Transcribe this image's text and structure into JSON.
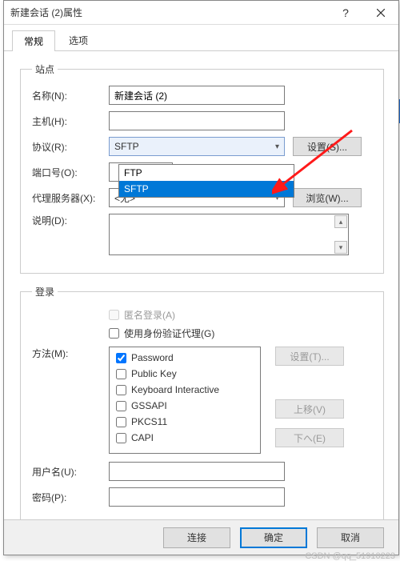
{
  "window": {
    "title": "新建会话 (2)属性",
    "help_icon": "?",
    "close_icon": "×"
  },
  "tabs": {
    "general": "常规",
    "options": "选项"
  },
  "site": {
    "legend": "站点",
    "name_label": "名称(N):",
    "name_value": "新建会话 (2)",
    "host_label": "主机(H):",
    "host_value": "",
    "protocol_label": "协议(R):",
    "protocol_value": "SFTP",
    "settings_btn": "设置(S)...",
    "port_label": "端口号(O):",
    "port_value": "",
    "proxy_label": "代理服务器(X):",
    "proxy_value": "<无>",
    "browse_btn": "浏览(W)...",
    "desc_label": "说明(D):"
  },
  "protocol_options": {
    "ftp": "FTP",
    "sftp": "SFTP"
  },
  "login": {
    "legend": "登录",
    "anon_label": "匿名登录(A)",
    "idproxy_label": "使用身份验证代理(G)",
    "method_label": "方法(M):",
    "methods": {
      "password": "Password",
      "publickey": "Public Key",
      "kbdint": "Keyboard Interactive",
      "gssapi": "GSSAPI",
      "pkcs11": "PKCS11",
      "capi": "CAPI"
    },
    "settings_btn": "设置(T)...",
    "moveup_btn": "上移(V)",
    "movedown_btn": "下へ(E)",
    "user_label": "用户名(U):",
    "user_value": "",
    "pass_label": "密码(P):",
    "pass_value": ""
  },
  "footer": {
    "connect": "连接",
    "ok": "确定",
    "cancel": "取消"
  },
  "watermark": "CSDN @qq_51910223"
}
